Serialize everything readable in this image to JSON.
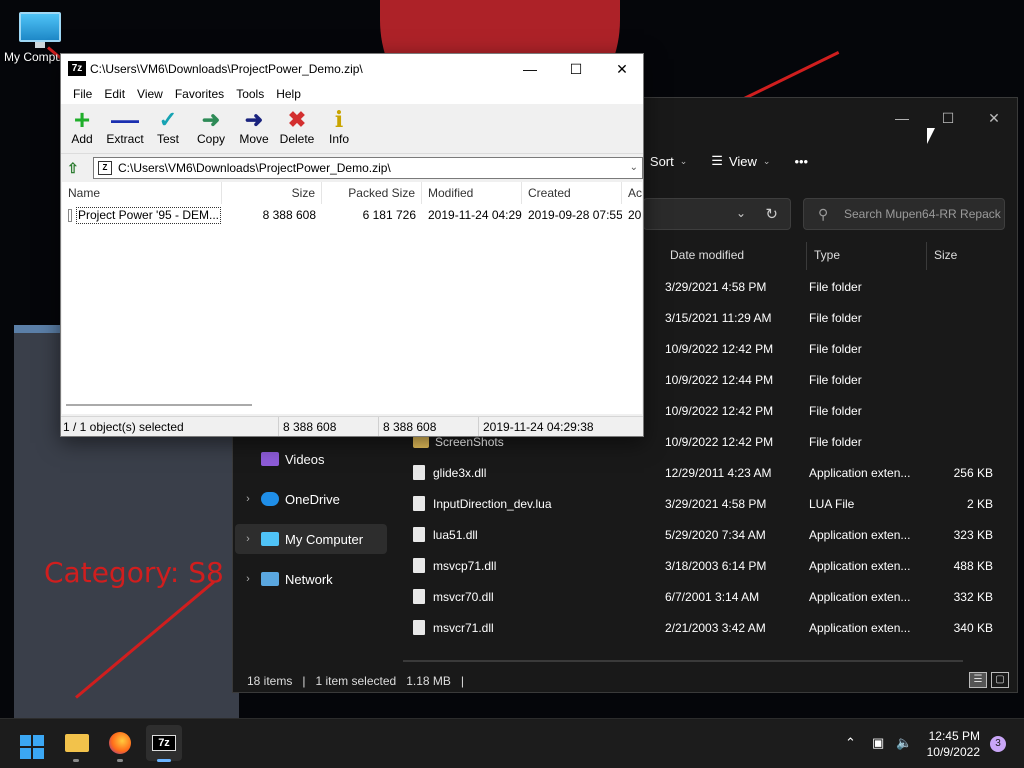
{
  "desktop": {
    "icon_label": "My Computer",
    "wallpaper_text": "Category: S8"
  },
  "explorer": {
    "toolbar": {
      "sort_label": "Sort",
      "view_label": "View",
      "more_label": "•••"
    },
    "search": {
      "placeholder": "Search Mupen64-RR Repack"
    },
    "columns": {
      "date": "Date modified",
      "type": "Type",
      "size": "Size"
    },
    "nav": [
      {
        "label": "Videos"
      },
      {
        "label": "OneDrive"
      },
      {
        "label": "My Computer"
      },
      {
        "label": "Network"
      }
    ],
    "rows": [
      {
        "name": "",
        "date": "3/29/2021 4:58 PM",
        "type": "File folder",
        "size": ""
      },
      {
        "name": "",
        "date": "3/15/2021 11:29 AM",
        "type": "File folder",
        "size": ""
      },
      {
        "name": "",
        "date": "10/9/2022 12:42 PM",
        "type": "File folder",
        "size": ""
      },
      {
        "name": "",
        "date": "10/9/2022 12:44 PM",
        "type": "File folder",
        "size": ""
      },
      {
        "name": "",
        "date": "10/9/2022 12:42 PM",
        "type": "File folder",
        "size": ""
      },
      {
        "name": "ScreenShots",
        "date": "10/9/2022 12:42 PM",
        "type": "File folder",
        "size": ""
      },
      {
        "name": "glide3x.dll",
        "date": "12/29/2011 4:23 AM",
        "type": "Application exten...",
        "size": "256 KB"
      },
      {
        "name": "InputDirection_dev.lua",
        "date": "3/29/2021 4:58 PM",
        "type": "LUA File",
        "size": "2 KB"
      },
      {
        "name": "lua51.dll",
        "date": "5/29/2020 7:34 AM",
        "type": "Application exten...",
        "size": "323 KB"
      },
      {
        "name": "msvcp71.dll",
        "date": "3/18/2003 6:14 PM",
        "type": "Application exten...",
        "size": "488 KB"
      },
      {
        "name": "msvcr70.dll",
        "date": "6/7/2001 3:14 AM",
        "type": "Application exten...",
        "size": "332 KB"
      },
      {
        "name": "msvcr71.dll",
        "date": "2/21/2003 3:42 AM",
        "type": "Application exten...",
        "size": "340 KB"
      }
    ],
    "status": {
      "items": "18 items",
      "selected": "1 item selected",
      "selsize": "1.18 MB",
      "sep": "|"
    }
  },
  "sevenzip": {
    "title": "C:\\Users\\VM6\\Downloads\\ProjectPower_Demo.zip\\",
    "menu": [
      "File",
      "Edit",
      "View",
      "Favorites",
      "Tools",
      "Help"
    ],
    "tools": [
      {
        "label": "Add",
        "icon": "plus-icon",
        "color": "#1fae2a"
      },
      {
        "label": "Extract",
        "icon": "minus-icon",
        "color": "#1a2fb0"
      },
      {
        "label": "Test",
        "icon": "check-icon",
        "color": "#16a3b3"
      },
      {
        "label": "Copy",
        "icon": "arrow-right-icon",
        "color": "#2e8b57"
      },
      {
        "label": "Move",
        "icon": "arrow-right-icon",
        "color": "#1a237e"
      },
      {
        "label": "Delete",
        "icon": "x-icon",
        "color": "#d32f2f"
      },
      {
        "label": "Info",
        "icon": "info-icon",
        "color": "#c9a400"
      }
    ],
    "path": "C:\\Users\\VM6\\Downloads\\ProjectPower_Demo.zip\\",
    "columns": {
      "name": "Name",
      "size": "Size",
      "packed": "Packed Size",
      "modified": "Modified",
      "created": "Created",
      "accessed": "Ac"
    },
    "row": {
      "name": "Project Power '95 - DEM...",
      "size": "8 388 608",
      "packed": "6 181 726",
      "modified": "2019-11-24 04:29",
      "created": "2019-09-28 07:55",
      "accessed": "20"
    },
    "status": {
      "selected": "1 / 1 object(s) selected",
      "size": "8 388 608",
      "packed": "8 388 608",
      "modified": "2019-11-24 04:29:38"
    }
  },
  "taskbar": {
    "time": "12:45 PM",
    "date": "10/9/2022",
    "notifications": "3",
    "sevenzip_label": "7z"
  }
}
